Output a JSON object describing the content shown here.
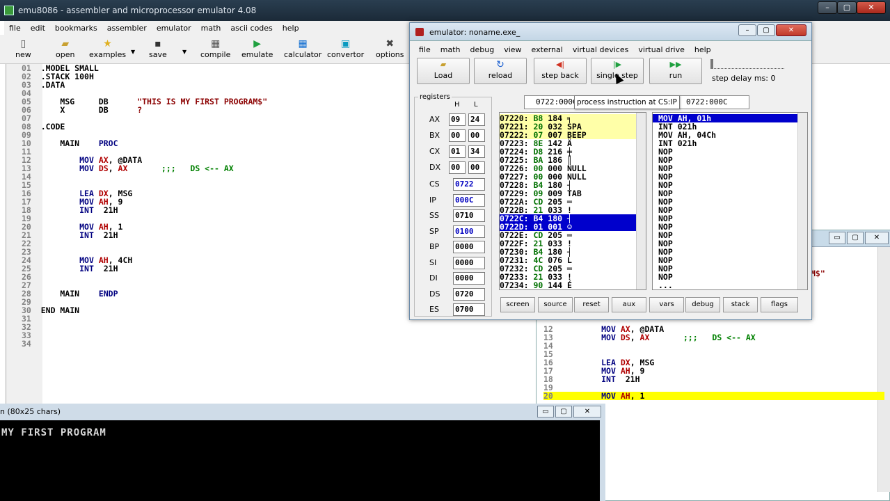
{
  "main": {
    "title": "emu8086 - assembler and microprocessor emulator 4.08",
    "menu": [
      "file",
      "edit",
      "bookmarks",
      "assembler",
      "emulator",
      "math",
      "ascii codes",
      "help"
    ],
    "toolbar": [
      "new",
      "open",
      "examples",
      "save",
      "compile",
      "emulate",
      "calculator",
      "convertor",
      "options"
    ],
    "code": [
      {
        "n": "01",
        "t": ".MODEL SMALL"
      },
      {
        "n": "02",
        "t": ".STACK 100H"
      },
      {
        "n": "03",
        "t": ".DATA"
      },
      {
        "n": "04",
        "t": ""
      },
      {
        "n": "05",
        "a": "    MSG     DB",
        "b": "      \"THIS IS MY FIRST PROGRAM$\""
      },
      {
        "n": "06",
        "a": "    X       DB",
        "b": "      ?"
      },
      {
        "n": "07",
        "t": ""
      },
      {
        "n": "08",
        "t": ".CODE"
      },
      {
        "n": "09",
        "t": ""
      },
      {
        "n": "10",
        "a": "    MAIN    ",
        "k": "PROC"
      },
      {
        "n": "11",
        "t": ""
      },
      {
        "n": "12",
        "i": "MOV",
        "r": "AX",
        "c": ", @DATA"
      },
      {
        "n": "13",
        "i": "MOV",
        "r": "DS",
        "c": ", ",
        "r2": "AX",
        "g": "       ;;;   DS <-- AX"
      },
      {
        "n": "14",
        "t": ""
      },
      {
        "n": "15",
        "t": ""
      },
      {
        "n": "16",
        "i": "LEA",
        "r": "DX",
        "c": ", MSG"
      },
      {
        "n": "17",
        "i": "MOV",
        "r": "AH",
        "c": ", 9"
      },
      {
        "n": "18",
        "i": "INT",
        "c": " 21H"
      },
      {
        "n": "19",
        "t": ""
      },
      {
        "n": "20",
        "i": "MOV",
        "r": "AH",
        "c": ", 1"
      },
      {
        "n": "21",
        "i": "INT",
        "c": " 21H"
      },
      {
        "n": "22",
        "t": ""
      },
      {
        "n": "23",
        "t": ""
      },
      {
        "n": "24",
        "i": "MOV",
        "r": "AH",
        "c": ", 4CH"
      },
      {
        "n": "25",
        "i": "INT",
        "c": " 21H"
      },
      {
        "n": "26",
        "t": ""
      },
      {
        "n": "27",
        "t": ""
      },
      {
        "n": "28",
        "a": "    MAIN    ",
        "k": "ENDP"
      },
      {
        "n": "29",
        "t": ""
      },
      {
        "n": "30",
        "t": "END MAIN"
      },
      {
        "n": "31",
        "t": ""
      },
      {
        "n": "32",
        "t": ""
      },
      {
        "n": "33",
        "t": ""
      },
      {
        "n": "34",
        "t": ""
      }
    ]
  },
  "emulator": {
    "title": "emulator: noname.exe_",
    "menu": [
      "file",
      "math",
      "debug",
      "view",
      "external",
      "virtual devices",
      "virtual drive",
      "help"
    ],
    "buttons": {
      "load": "Load",
      "reload": "reload",
      "step_back": "step back",
      "single_step": "single step",
      "run": "run"
    },
    "step_delay": "step delay ms: 0",
    "registers_label": "registers",
    "h_label": "H",
    "l_label": "L",
    "address1": "0722:000C",
    "address2": "0722:000C",
    "tooltip": "process instruction at CS:IP",
    "regs8": [
      {
        "n": "AX",
        "h": "09",
        "l": "24"
      },
      {
        "n": "BX",
        "h": "00",
        "l": "00"
      },
      {
        "n": "CX",
        "h": "01",
        "l": "34"
      },
      {
        "n": "DX",
        "h": "00",
        "l": "00"
      }
    ],
    "regs16": [
      {
        "n": "CS",
        "v": "0722",
        "blue": true
      },
      {
        "n": "IP",
        "v": "000C",
        "blue": true
      },
      {
        "n": "SS",
        "v": "0710",
        "blue": false
      },
      {
        "n": "SP",
        "v": "0100",
        "blue": true
      },
      {
        "n": "BP",
        "v": "0000",
        "blue": false
      },
      {
        "n": "SI",
        "v": "0000",
        "blue": false
      },
      {
        "n": "DI",
        "v": "0000",
        "blue": false
      },
      {
        "n": "DS",
        "v": "0720",
        "blue": false
      },
      {
        "n": "ES",
        "v": "0700",
        "blue": false
      }
    ],
    "memory": [
      {
        "a": "07220:",
        "h": "B8",
        "d": "184",
        "c": "╕",
        "s": "y"
      },
      {
        "a": "07221:",
        "h": "20",
        "d": "032",
        "c": "SPA",
        "s": "y"
      },
      {
        "a": "07222:",
        "h": "07",
        "d": "007",
        "c": "BEEP",
        "s": "y"
      },
      {
        "a": "07223:",
        "h": "8E",
        "d": "142",
        "c": "Ä",
        "s": ""
      },
      {
        "a": "07224:",
        "h": "D8",
        "d": "216",
        "c": "╪",
        "s": ""
      },
      {
        "a": "07225:",
        "h": "BA",
        "d": "186",
        "c": "║",
        "s": ""
      },
      {
        "a": "07226:",
        "h": "00",
        "d": "000",
        "c": "NULL",
        "s": ""
      },
      {
        "a": "07227:",
        "h": "00",
        "d": "000",
        "c": "NULL",
        "s": ""
      },
      {
        "a": "07228:",
        "h": "B4",
        "d": "180",
        "c": "┤",
        "s": ""
      },
      {
        "a": "07229:",
        "h": "09",
        "d": "009",
        "c": "TAB",
        "s": ""
      },
      {
        "a": "0722A:",
        "h": "CD",
        "d": "205",
        "c": "═",
        "s": ""
      },
      {
        "a": "0722B:",
        "h": "21",
        "d": "033",
        "c": "!",
        "s": ""
      },
      {
        "a": "0722C:",
        "h": "B4",
        "d": "180",
        "c": "┤",
        "s": "b"
      },
      {
        "a": "0722D:",
        "h": "01",
        "d": "001",
        "c": "☺",
        "s": "b"
      },
      {
        "a": "0722E:",
        "h": "CD",
        "d": "205",
        "c": "═",
        "s": ""
      },
      {
        "a": "0722F:",
        "h": "21",
        "d": "033",
        "c": "!",
        "s": ""
      },
      {
        "a": "07230:",
        "h": "B4",
        "d": "180",
        "c": "┤",
        "s": ""
      },
      {
        "a": "07231:",
        "h": "4C",
        "d": "076",
        "c": "L",
        "s": ""
      },
      {
        "a": "07232:",
        "h": "CD",
        "d": "205",
        "c": "═",
        "s": ""
      },
      {
        "a": "07233:",
        "h": "21",
        "d": "033",
        "c": "!",
        "s": ""
      },
      {
        "a": "07234:",
        "h": "90",
        "d": "144",
        "c": "É",
        "s": ""
      }
    ],
    "disasm": [
      "MOV AH, 01h",
      "INT 021h",
      "MOV AH, 04Ch",
      "INT 021h",
      "NOP",
      "NOP",
      "NOP",
      "NOP",
      "NOP",
      "NOP",
      "NOP",
      "NOP",
      "NOP",
      "NOP",
      "NOP",
      "NOP",
      "NOP",
      "NOP",
      "NOP",
      "NOP",
      "..."
    ],
    "bottom_buttons": [
      "screen",
      "source",
      "reset",
      "aux",
      "vars",
      "debug",
      "stack",
      "flags"
    ]
  },
  "source": {
    "partial": "M$\"",
    "lines": [
      {
        "n": "12",
        "i": "MOV",
        "r": "AX",
        "c": ", @DATA"
      },
      {
        "n": "13",
        "i": "MOV",
        "r": "DS",
        "c": ", ",
        "r2": "AX",
        "g": "       ;;;   DS <-- AX"
      },
      {
        "n": "14",
        "t": ""
      },
      {
        "n": "15",
        "t": ""
      },
      {
        "n": "16",
        "i": "LEA",
        "r": "DX",
        "c": ", MSG"
      },
      {
        "n": "17",
        "i": "MOV",
        "r": "AH",
        "c": ", 9"
      },
      {
        "n": "18",
        "i": "INT",
        "c": " 21H"
      },
      {
        "n": "19",
        "t": ""
      },
      {
        "n": "20",
        "i": "MOV",
        "r": "AH",
        "c": ", 1",
        "hl": true
      }
    ]
  },
  "screen": {
    "title": "n (80x25 chars)",
    "output": "MY FIRST PROGRAM"
  }
}
